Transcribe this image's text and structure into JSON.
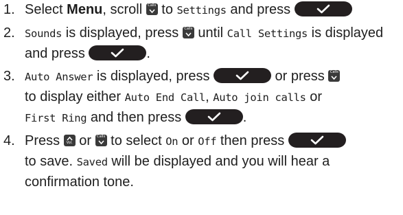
{
  "steps": [
    {
      "number": "1.",
      "t1": "Select ",
      "menu": "Menu",
      "t2": ", scroll ",
      "key_calls": "Calls",
      "t3": " to ",
      "settings": "Settings",
      "t4": " and press "
    },
    {
      "number": "2.",
      "sounds": "Sounds",
      "t1": " is displayed, press ",
      "key_calls": "Calls",
      "t2": " until ",
      "call_settings": "Call Settings",
      "t3": " is displayed and press ",
      "t4": "."
    },
    {
      "number": "3.",
      "auto_answer": "Auto Answer",
      "t1": " is displayed, press ",
      "t2": " or press ",
      "key_calls": "Calls",
      "t3": "to display either ",
      "auto_end_call": "Auto End Call",
      "t4": ", ",
      "auto_join": "Auto join calls",
      "t5": " or ",
      "first_ring": "First Ring",
      "t6": " and then press ",
      "t7": "."
    },
    {
      "number": "4.",
      "t1": "Press ",
      "key_vol": "Vol.",
      "t2": " or ",
      "key_calls": "Calls",
      "t3": " to select ",
      "on": "On",
      "t4": " or ",
      "off": "Off",
      "t5": " then press ",
      "t6": "to save. ",
      "saved": "Saved",
      "t7": " will be displayed and you will hear a confirmation tone."
    }
  ],
  "icons": {
    "ok_button": "checkmark-button-icon",
    "calls_key": "calls-down-key-icon",
    "vol_key": "vol-up-key-icon"
  },
  "colors": {
    "text": "#1e1e1e",
    "button": "#231f20",
    "key": "#3a3a3a"
  }
}
